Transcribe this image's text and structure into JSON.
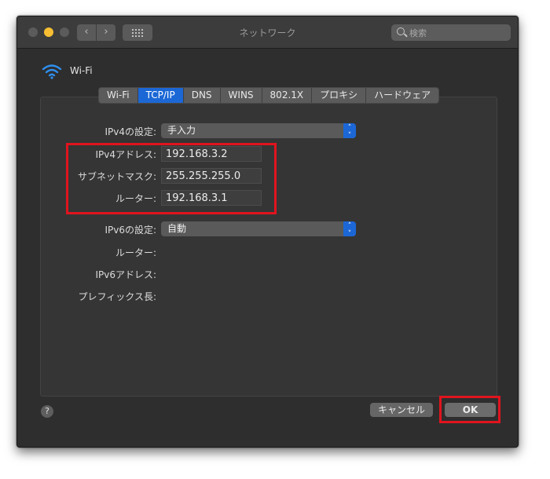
{
  "window": {
    "title": "ネットワーク",
    "search_placeholder": "検索"
  },
  "interface": {
    "name": "Wi-Fi"
  },
  "tabs": [
    "Wi-Fi",
    "TCP/IP",
    "DNS",
    "WINS",
    "802.1X",
    "プロキシ",
    "ハードウェア"
  ],
  "active_tab": "TCP/IP",
  "ipv4": {
    "config_label": "IPv4の設定:",
    "config_value": "手入力",
    "address_label": "IPv4アドレス:",
    "address_value": "192.168.3.2",
    "subnet_label": "サブネットマスク:",
    "subnet_value": "255.255.255.0",
    "router_label": "ルーター:",
    "router_value": "192.168.3.1"
  },
  "ipv6": {
    "config_label": "IPv6の設定:",
    "config_value": "自動",
    "router_label": "ルーター:",
    "address_label": "IPv6アドレス:",
    "prefix_label": "プレフィックス長:"
  },
  "buttons": {
    "help": "?",
    "cancel": "キャンセル",
    "ok": "OK"
  },
  "colors": {
    "accent": "#1c67d6",
    "highlight": "#e0141e",
    "traffic_yellow": "#f7be33"
  },
  "icons": {
    "wifi": "wifi-icon",
    "search": "search-icon",
    "back": "chevron-left-icon",
    "forward": "chevron-right-icon",
    "grid": "grid-icon",
    "popup": "up-down-chevron-icon"
  }
}
